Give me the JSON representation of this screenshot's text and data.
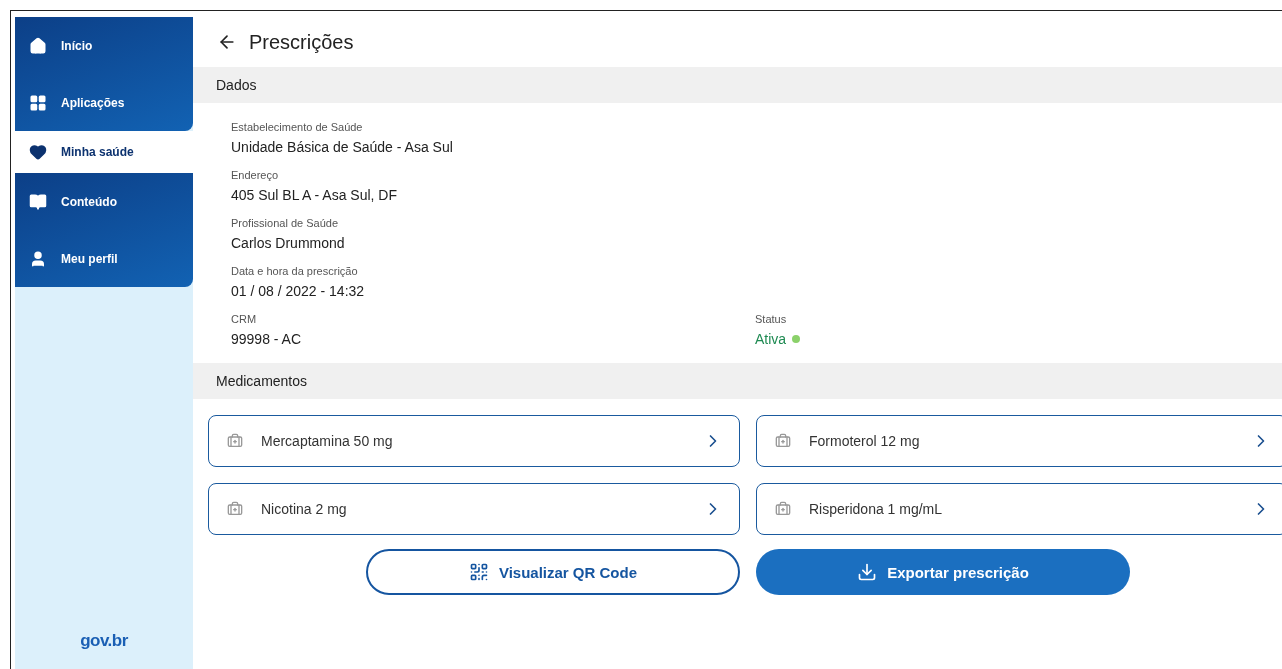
{
  "sidebar": {
    "items": [
      {
        "label": "Início",
        "kind": "home",
        "selected": false
      },
      {
        "label": "Aplicações",
        "kind": "apps",
        "selected": false
      },
      {
        "label": "Minha saúde",
        "kind": "health",
        "selected": true
      },
      {
        "label": "Conteúdo",
        "kind": "content",
        "selected": false
      },
      {
        "label": "Meu perfil",
        "kind": "profile",
        "selected": false
      }
    ],
    "logo": "gov.br"
  },
  "header": {
    "title": "Prescrições"
  },
  "sections": [
    {
      "title": "Dados"
    },
    {
      "title": "Medicamentos"
    }
  ],
  "fields": [
    {
      "label": "Estabelecimento de Saúde",
      "value": "Unidade Básica de Saúde - Asa Sul"
    },
    {
      "label": "Endereço",
      "value": "405 Sul BL A - Asa Sul, DF"
    },
    {
      "label": "Profissional de Saúde",
      "value": "Carlos Drummond"
    },
    {
      "label": "Data e hora da prescrição",
      "value": "01 / 08 / 2022 - 14:32"
    },
    {
      "label": "CRM",
      "value": "99998 - AC"
    }
  ],
  "status": {
    "label": "Status",
    "value": "Ativa",
    "color": "#8bd16a"
  },
  "medicines": [
    {
      "name": "Mercaptamina 50 mg"
    },
    {
      "name": "Formoterol 12 mg"
    },
    {
      "name": "Nicotina 2 mg"
    },
    {
      "name": "Risperidona 1 mg/mL"
    }
  ],
  "buttons": [
    {
      "label": "Visualizar QR Code",
      "kind": "outline"
    },
    {
      "label": "Exportar prescrição",
      "kind": "primary"
    }
  ]
}
